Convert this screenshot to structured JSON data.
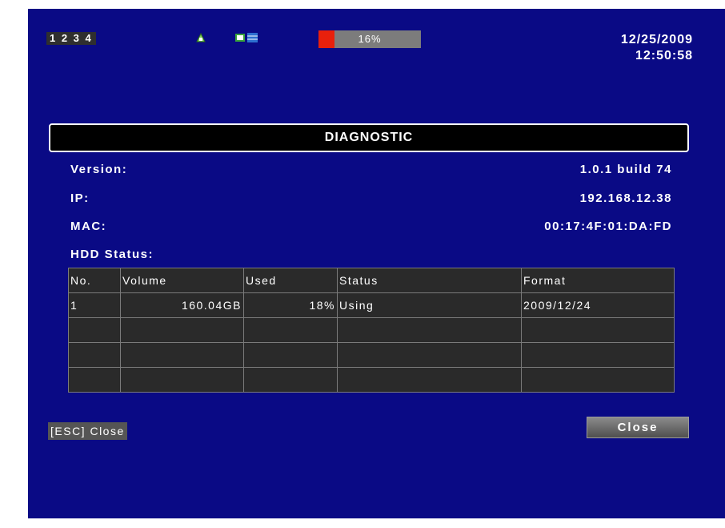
{
  "status_bar": {
    "channels": "1 2 3 4",
    "hdd_usage_text": "16%",
    "hdd_usage_fraction": 0.16,
    "date": "12/25/2009",
    "time": "12:50:58",
    "icons": [
      "network-icon",
      "record-icon"
    ]
  },
  "dialog": {
    "title": "DIAGNOSTIC",
    "version_label": "Version:",
    "version_value": "1.0.1 build 74",
    "ip_label": "IP:",
    "ip_value": "192.168.12.38",
    "mac_label": "MAC:",
    "mac_value": "00:17:4F:01:DA:FD",
    "hdd_status_label": "HDD Status:",
    "table": {
      "headers": [
        "No.",
        "Volume",
        "Used",
        "Status",
        "Format"
      ],
      "rows": [
        [
          "1",
          "160.04GB",
          "18%",
          "Using",
          "2009/12/24"
        ],
        [
          "",
          "",
          "",
          "",
          ""
        ],
        [
          "",
          "",
          "",
          "",
          ""
        ],
        [
          "",
          "",
          "",
          "",
          ""
        ]
      ]
    },
    "esc_hint": "[ESC] Close",
    "close_label": "Close"
  },
  "colors": {
    "background": "#0a0a85",
    "hdd_fill": "#e8200c",
    "header_bar": "#000000"
  }
}
